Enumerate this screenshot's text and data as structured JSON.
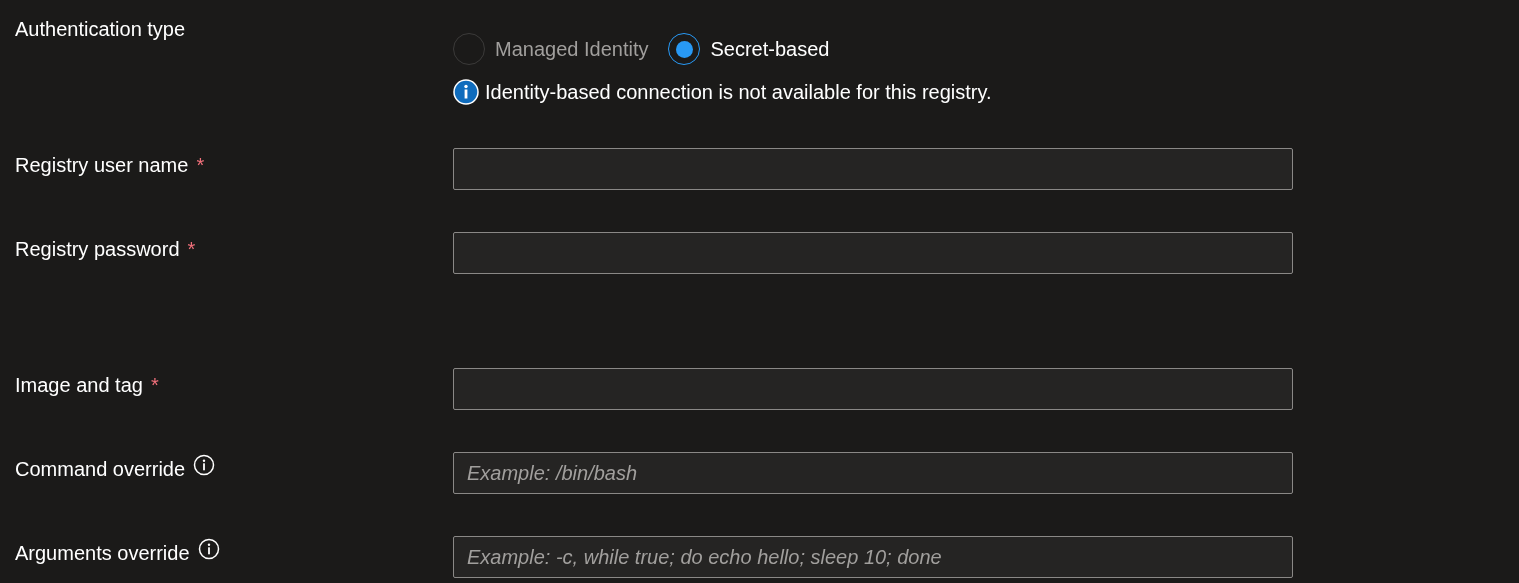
{
  "authentication": {
    "label": "Authentication type",
    "options": [
      {
        "label": "Managed Identity",
        "selected": false,
        "disabled": true
      },
      {
        "label": "Secret-based",
        "selected": true,
        "disabled": false
      }
    ],
    "notice": "Identity-based connection is not available for this registry."
  },
  "field_groups": [
    [
      {
        "label": "Registry user name",
        "required_mark": "*",
        "info": false
      },
      {
        "label": "Registry password",
        "required_mark": "*",
        "info": false
      }
    ],
    [
      {
        "label": "Image and tag",
        "required_mark": "*",
        "info": false
      },
      {
        "label": "Command override",
        "info": true,
        "placeholder": "Example: /bin/bash"
      },
      {
        "label": "Arguments override",
        "info": true,
        "placeholder": "Example: -c, while true; do echo hello; sleep 10; done"
      }
    ]
  ]
}
